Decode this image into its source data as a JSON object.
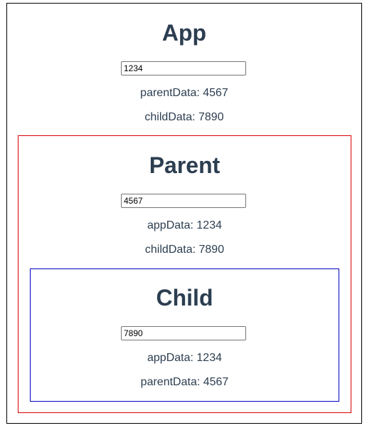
{
  "app": {
    "title": "App",
    "input_value": "1234",
    "line1_label": "parentData",
    "line1_value": "4567",
    "line2_label": "childData",
    "line2_value": "7890",
    "border_color": "#000000"
  },
  "parent": {
    "title": "Parent",
    "input_value": "4567",
    "line1_label": "appData",
    "line1_value": "1234",
    "line2_label": "childData",
    "line2_value": "7890",
    "border_color": "#d90000"
  },
  "child": {
    "title": "Child",
    "input_value": "7890",
    "line1_label": "appData",
    "line1_value": "1234",
    "line2_label": "parentData",
    "line2_value": "4567",
    "border_color": "#0000c0"
  },
  "separator": ": "
}
